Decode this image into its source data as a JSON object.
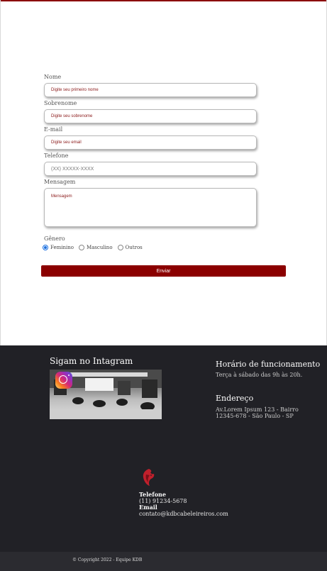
{
  "colors": {
    "accent": "#8b0000",
    "footer_bg": "#212126",
    "bottom_bar_bg": "#2b2b30"
  },
  "form": {
    "fields": [
      {
        "label": "Nome",
        "placeholder": "Digite seu primeiro nome"
      },
      {
        "label": "Sobrenome",
        "placeholder": "Digite seu sobrenome"
      },
      {
        "label": "E-mail",
        "placeholder": "Digite seu email"
      },
      {
        "label": "Telefone",
        "placeholder": "(XX) XXXXX-XXXX"
      },
      {
        "label": "Mensagem",
        "placeholder": "Mensagem"
      }
    ],
    "gender": {
      "title": "Gênero",
      "options": [
        "Feminino",
        "Masculino",
        "Outros"
      ],
      "selected": "Feminino"
    },
    "submit_label": "Enviar"
  },
  "footer": {
    "instagram_title": "Sigam no Intagram",
    "instagram_icon": "instagram-icon",
    "hours_title": "Horário de funcionamento",
    "hours_text": "Terça à sábado das 9h às 20h.",
    "address_title": "Endereço",
    "address_line1": "Av.Lorem Ipsum 123 - Bairro",
    "address_line2": "12345-678 - São Paulo - SP",
    "brand_icon": "lion-logo-icon",
    "phone_label": "Telefone",
    "phone_value": "(11) 91234-5678",
    "email_label": "Email",
    "email_value": "contato@kdbcabeleireiros.com"
  },
  "copyright": "© Copyright 2022 - Equipe KDB"
}
